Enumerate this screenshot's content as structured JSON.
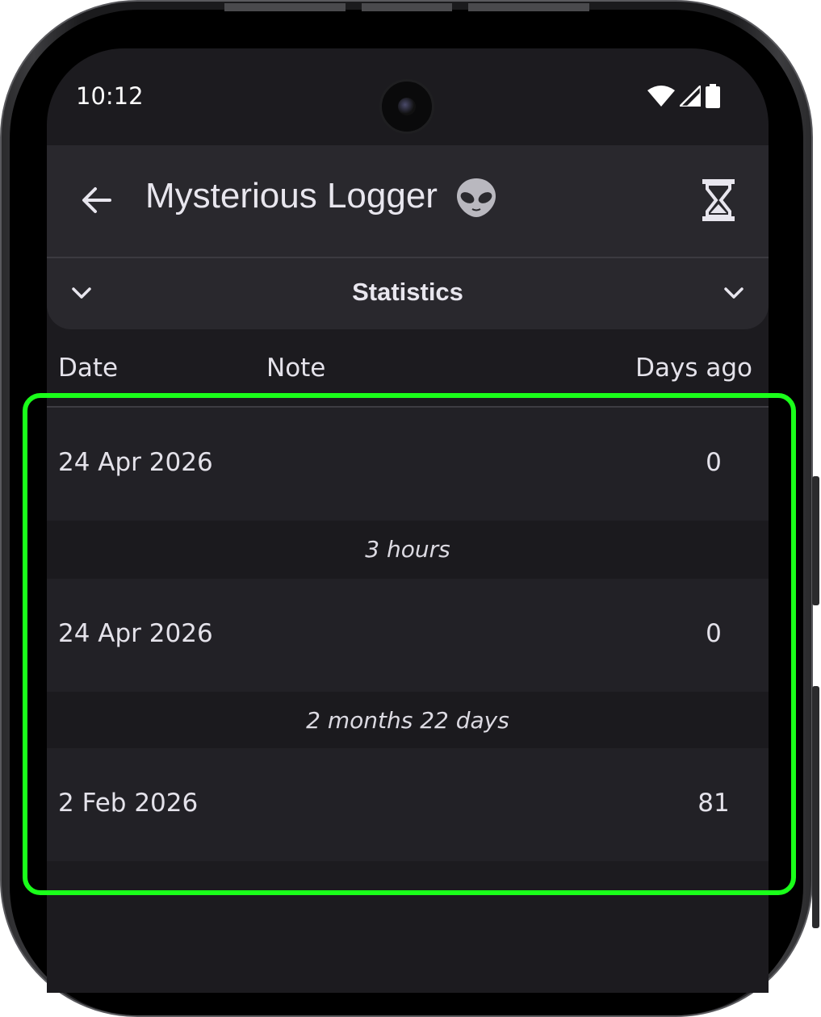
{
  "status_bar": {
    "time": "10:12"
  },
  "app_bar": {
    "title": "Mysterious Logger",
    "title_emoji": "👽"
  },
  "statistics": {
    "label": "Statistics"
  },
  "table": {
    "headers": {
      "date": "Date",
      "note": "Note",
      "days_ago": "Days ago"
    },
    "rows": [
      {
        "date": "24 Apr 2026",
        "note": "",
        "days_ago": "0"
      },
      {
        "date": "24 Apr 2026",
        "note": "",
        "days_ago": "0"
      },
      {
        "date": "2 Feb 2026",
        "note": "",
        "days_ago": "81"
      }
    ],
    "intervals": [
      "3 hours",
      "2 months 22 days"
    ]
  },
  "colors": {
    "highlight": "#1aff1a",
    "background": "#1c1b1f",
    "surface": "#29282d"
  }
}
